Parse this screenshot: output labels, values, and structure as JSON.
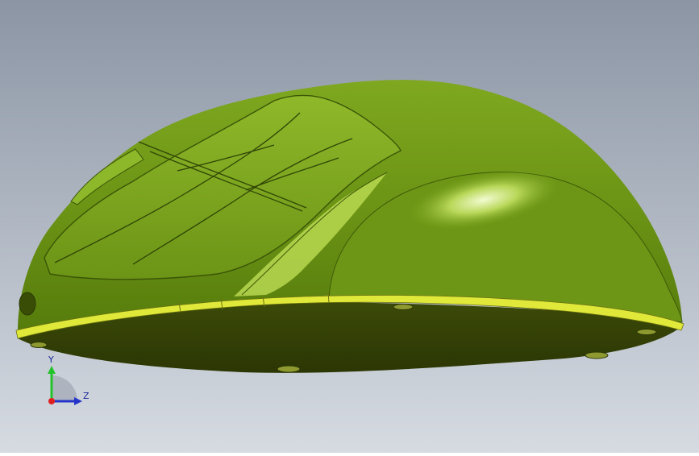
{
  "viewport": {
    "background_top": "#8e98a6",
    "background_bottom": "#d3d8e0",
    "model_color": "#6f9a1a",
    "model_highlight": "#d8f09a",
    "model_shadow": "#2b3a04",
    "edge_band_color": "#e6ec3a"
  },
  "triad": {
    "y_label": "Y",
    "z_label": "Z",
    "y_color": "#22c22a",
    "z_color": "#2434c8",
    "x_color": "#e02020"
  }
}
